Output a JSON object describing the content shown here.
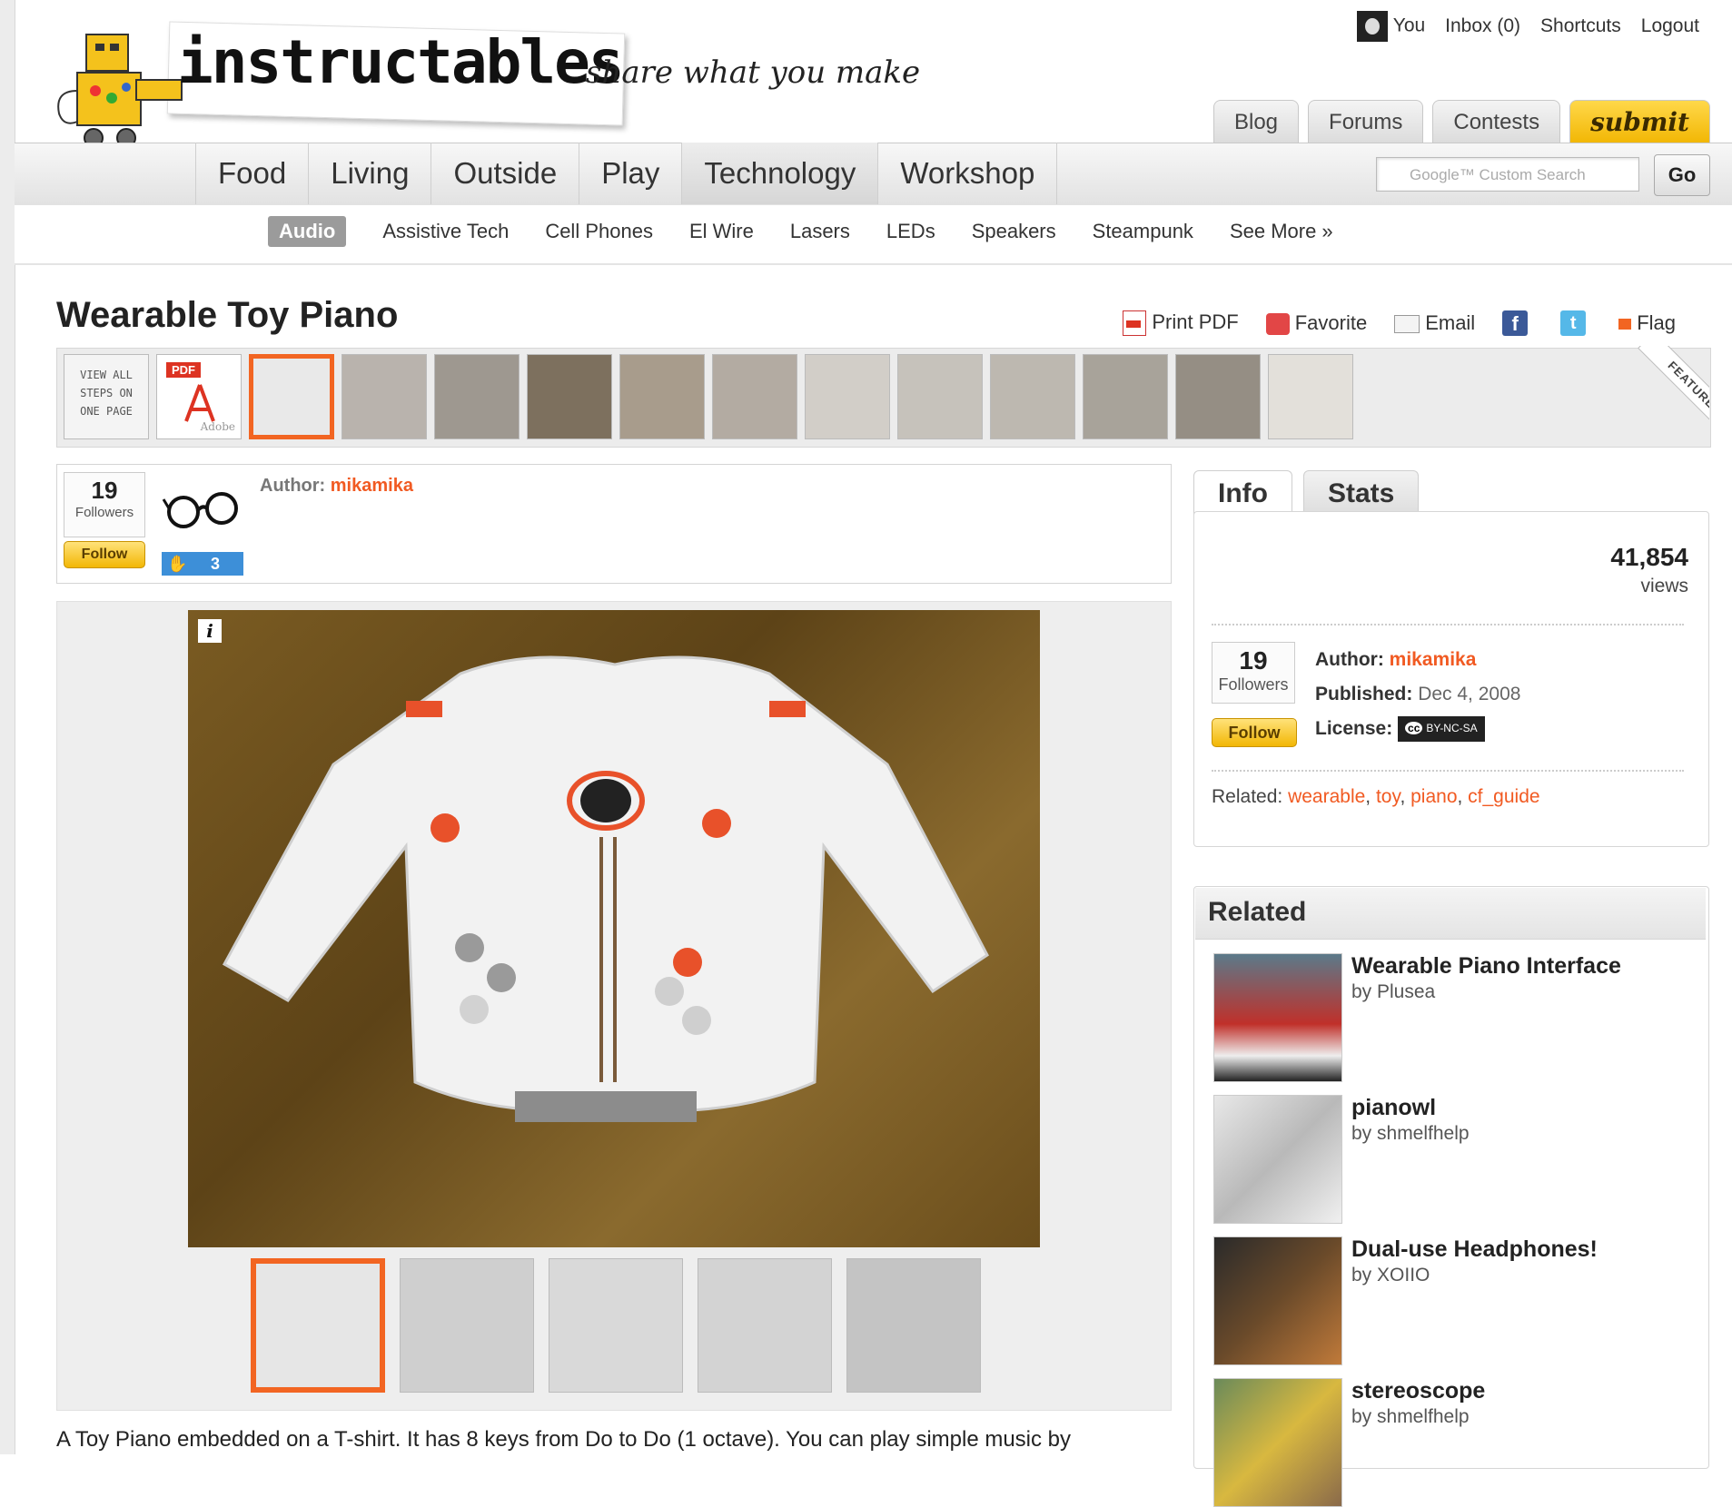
{
  "header": {
    "logo_text": "instructables",
    "tagline": "share what you make",
    "topnav": [
      "You",
      "Inbox (0)",
      "Shortcuts",
      "Logout"
    ],
    "pill_tabs": [
      "Blog",
      "Forums",
      "Contests",
      "submit"
    ],
    "categories": [
      "Food",
      "Living",
      "Outside",
      "Play",
      "Technology",
      "Workshop"
    ],
    "active_category": "Technology",
    "search": {
      "placeholder": "Google™ Custom Search",
      "go_label": "Go"
    },
    "subcategories": [
      "Audio",
      "Assistive Tech",
      "Cell Phones",
      "El Wire",
      "Lasers",
      "LEDs",
      "Speakers",
      "Steampunk",
      "See More »"
    ],
    "active_subcategory": "Audio"
  },
  "page": {
    "title": "Wearable Toy Piano",
    "actions": [
      "Print PDF",
      "Favorite",
      "Email",
      "Flag"
    ],
    "strip": {
      "view_all": "VIEW ALL STEPS ON ONE PAGE",
      "pdf_tag": "PDF",
      "adobe": "Adobe",
      "featured": "FEATURED"
    }
  },
  "author_box": {
    "followers_count": "19",
    "followers_label": "Followers",
    "follow_label": "Follow",
    "patch_count": "3",
    "author_label": "Author:",
    "author_name": "mikamika"
  },
  "image_area": {
    "info_icon": "i"
  },
  "description": "A Toy Piano embedded on a T-shirt. It has 8 keys from Do to Do (1 octave). You can play simple music by",
  "info_panel": {
    "tabs": [
      "Info",
      "Stats"
    ],
    "views_count": "41,854",
    "views_label": "views",
    "followers_count": "19",
    "followers_label": "Followers",
    "follow_label": "Follow",
    "author_label": "Author:",
    "author_name": "mikamika",
    "published_label": "Published:",
    "published_value": "Dec 4, 2008",
    "license_label": "License:",
    "license_cc": "cc",
    "license_value": "BY-NC-SA",
    "related_label": "Related:",
    "related_tags": [
      "wearable",
      "toy",
      "piano",
      "cf_guide"
    ]
  },
  "related": {
    "heading": "Related",
    "items": [
      {
        "title": "Wearable Piano Interface",
        "by": "by Plusea"
      },
      {
        "title": "pianowl",
        "by": "by shmelfhelp"
      },
      {
        "title": "Dual-use Headphones!",
        "by": "by XOIIO"
      },
      {
        "title": "stereoscope",
        "by": "by shmelfhelp"
      }
    ]
  },
  "colors": {
    "accent": "#f26522",
    "link": "#f15a22",
    "follow_button": "#f2b705"
  }
}
